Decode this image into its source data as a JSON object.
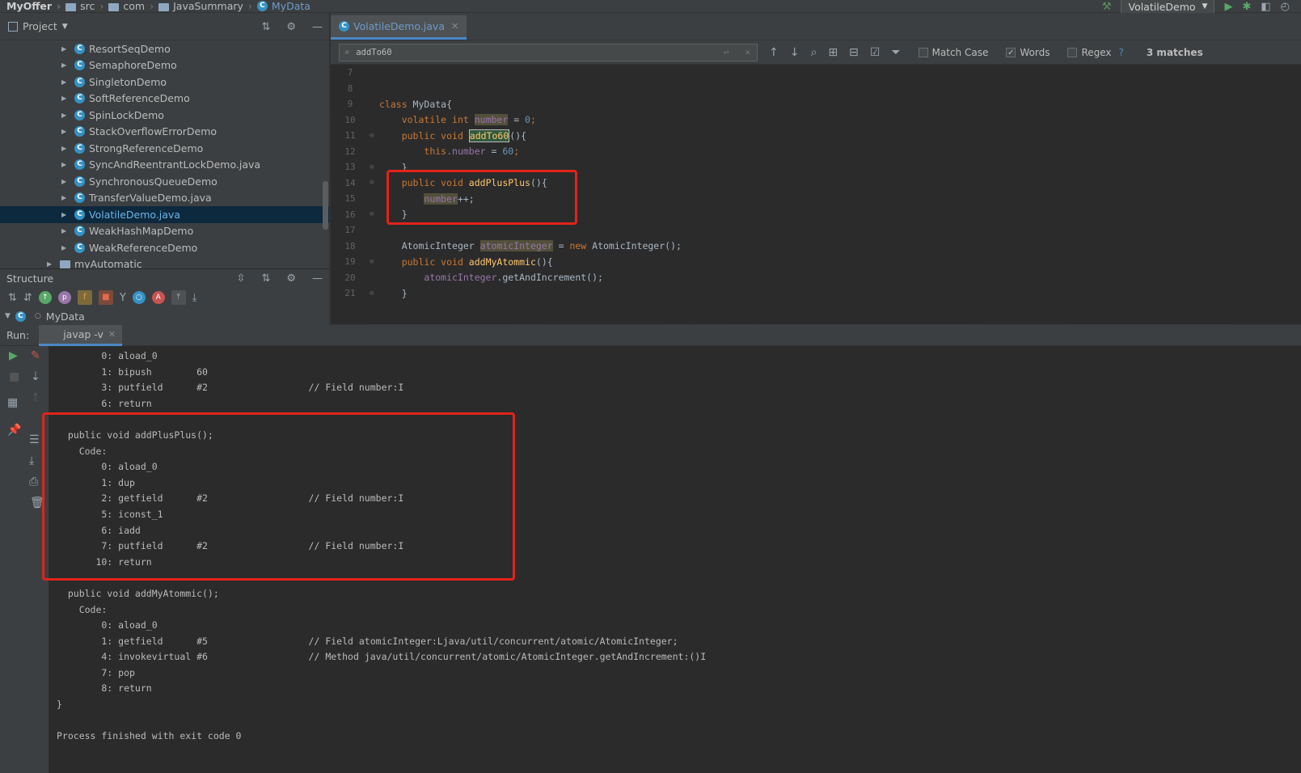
{
  "navbar": {
    "project": "MyOffer",
    "crumbs": [
      "src",
      "com",
      "JavaSummary"
    ],
    "current": "MyData",
    "run_config": "VolatileDemo"
  },
  "project_panel": {
    "title": "Project",
    "items": [
      "ResortSeqDemo",
      "SemaphoreDemo",
      "SingletonDemo",
      "SoftReferenceDemo",
      "SpinLockDemo",
      "StackOverflowErrorDemo",
      "StrongReferenceDemo",
      "SyncAndReentrantLockDemo.java",
      "SynchronousQueueDemo",
      "TransferValueDemo.java",
      "VolatileDemo.java",
      "WeakHashMapDemo",
      "WeakReferenceDemo"
    ],
    "selected_index": 10,
    "folder": "myAutomatic"
  },
  "structure_panel": {
    "title": "Structure",
    "root": "MyData"
  },
  "editor": {
    "tab": "VolatileDemo.java",
    "search": {
      "query": "addTo60",
      "match_case": "Match Case",
      "words": "Words",
      "regex": "Regex",
      "help": "?",
      "matches": "3 matches"
    },
    "line_numbers": [
      "7",
      "8",
      "9",
      "10",
      "11",
      "12",
      "13",
      "14",
      "15",
      "16",
      "17",
      "18",
      "19",
      "20",
      "21"
    ],
    "code": {
      "class_kw": "class ",
      "class_name": "MyData",
      "brace_open": "{",
      "volatile_kw": "volatile int ",
      "number": "number",
      "eq_zero": " = ",
      "zero": "0",
      "semi": ";",
      "public_void": "public void ",
      "addTo60": "addTo60",
      "paren_brace": "(){",
      "this_kw": "this",
      "dot_number": ".number",
      "eq": " = ",
      "sixty": "60",
      "close": "}",
      "addPlusPlus": "addPlusPlus",
      "plusplus": "++;",
      "atomic_type": "AtomicInteger ",
      "atomicInteger": "atomicInteger",
      "eq_new": " = ",
      "new_kw": "new ",
      "atomic_ctor": "AtomicInteger();",
      "addMyAtommic": "addMyAtommic",
      "get_and_inc": ".getAndIncrement();"
    }
  },
  "run_panel": {
    "label": "Run:",
    "tab": "javap -v",
    "lines": [
      "        0: aload_0",
      "        1: bipush        60",
      "        3: putfield      #2                  // Field number:I",
      "        6: return",
      "",
      "  public void addPlusPlus();",
      "    Code:",
      "        0: aload_0",
      "        1: dup",
      "        2: getfield      #2                  // Field number:I",
      "        5: iconst_1",
      "        6: iadd",
      "        7: putfield      #2                  // Field number:I",
      "       10: return",
      "",
      "  public void addMyAtommic();",
      "    Code:",
      "        0: aload_0",
      "        1: getfield      #5                  // Field atomicInteger:Ljava/util/concurrent/atomic/AtomicInteger;",
      "        4: invokevirtual #6                  // Method java/util/concurrent/atomic/AtomicInteger.getAndIncrement:()I",
      "        7: pop",
      "        8: return",
      "}",
      "",
      "Process finished with exit code 0"
    ]
  }
}
